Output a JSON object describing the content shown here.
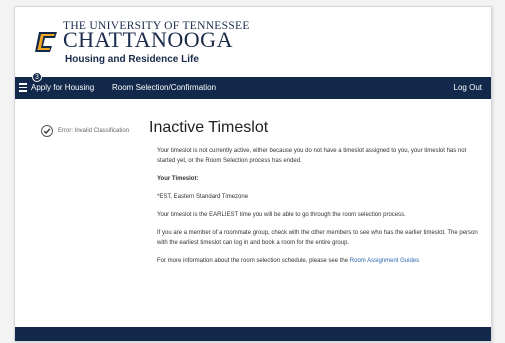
{
  "header": {
    "line1": "THE UNIVERSITY OF TENNESSEE",
    "line2": "CHATTANOOGA",
    "line3": "Housing and Residence Life",
    "logo_letter": "C",
    "brand_color": "#13294b",
    "accent_color": "#f0a821"
  },
  "nav": {
    "badge": "3",
    "items": [
      "Apply for Housing",
      "Room Selection/Confirmation"
    ],
    "logout": "Log Out"
  },
  "status": {
    "label": "Error: Invalid Classification"
  },
  "main": {
    "title": "Inactive Timeslot",
    "p1": "Your timeslot is not currently active, either because you do not have a timeslot assigned to you, your timeslot has not started yet, or the Room Selection process has ended.",
    "p2": "Your Timeslot:",
    "p3": "*EST, Eastern Standard Timezone",
    "p4": "Your timeslot is the EARLIEST time you will be able to go through the room selection process.",
    "p5": "If you are a member of a roommate group, check with the other members to see who has the earlier timeslot. The person with the earliest timeslot can log in and book a room for the entire group.",
    "p6_prefix": "For more information about the room selection schedule, please see the",
    "p6_link": "Room Assignment Guides"
  }
}
